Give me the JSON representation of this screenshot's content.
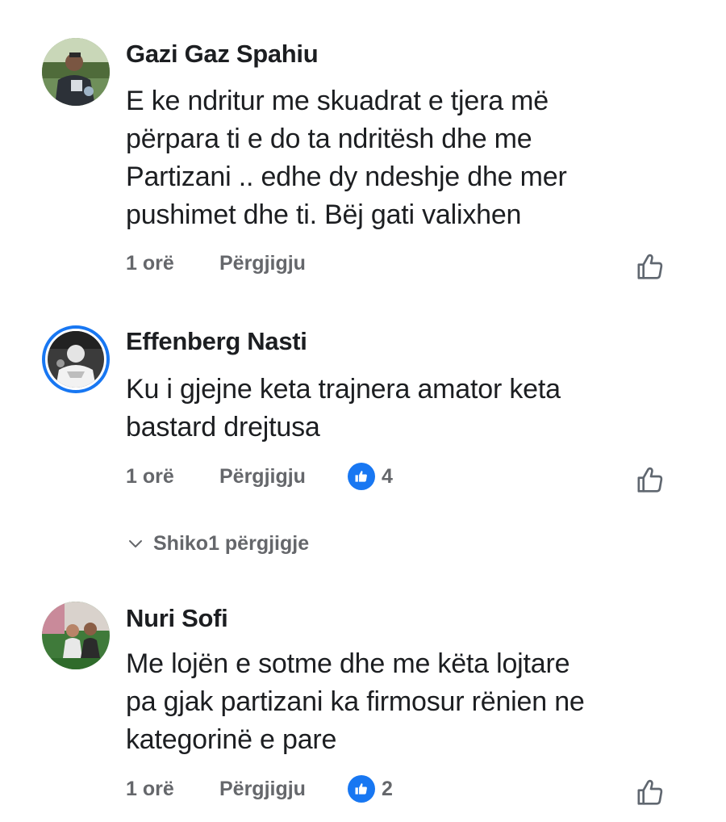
{
  "colors": {
    "accent": "#1877f2",
    "text": "#1c1e21",
    "muted": "#65676b"
  },
  "comments": [
    {
      "author": "Gazi Gaz Spahiu",
      "lines": [
        "E ke ndritur me skuadrat e tjera më",
        "përpara ti e do ta ndritësh dhe me",
        "Partizani .. edhe dy ndeshje dhe mer",
        "pushimet dhe ti. Bëj gati valixhen"
      ],
      "time": "1 orë",
      "reply_label": "Përgjigju"
    },
    {
      "author": "Effenberg Nasti",
      "lines": [
        "Ku i gjejne keta trajnera amator keta",
        "bastard drejtusa"
      ],
      "time": "1 orë",
      "reply_label": "Përgjigju",
      "reaction_count": "4",
      "view_replies_label": "Shiko1 përgjigje"
    },
    {
      "author": "Nuri Sofi",
      "lines": [
        "Me lojën e sotme dhe me këta lojtare",
        "pa gjak partizani ka firmosur rënien ne",
        "kategorinë e pare"
      ],
      "time": "1 orë",
      "reply_label": "Përgjigju",
      "reaction_count": "2"
    }
  ],
  "icons": {
    "like": "thumbs-up-outline-icon",
    "reaction": "like-reaction-icon",
    "expand": "chevron-down-icon"
  }
}
